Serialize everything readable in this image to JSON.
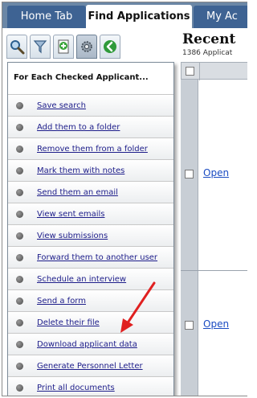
{
  "tabs": {
    "home": "Home Tab",
    "find": "Find Applications",
    "my": "My Ac"
  },
  "toolbar": {
    "icons": [
      "search-icon",
      "filter-icon",
      "add-document-icon",
      "settings-icon",
      "back-arrow-icon"
    ]
  },
  "menu": {
    "header": "For Each Checked Applicant...",
    "items": [
      "Save search",
      "Add them to a folder",
      "Remove them from a folder",
      "Mark them with notes",
      "Send them an email",
      "View sent emails",
      "View submissions",
      "Forward them to another user",
      "Schedule an interview",
      "Send a form",
      "Delete their file",
      "Download applicant data",
      "Generate Personnel Letter",
      "Print all documents"
    ]
  },
  "results": {
    "title": "Recent",
    "subtitle": "1386 Applicat",
    "open_label": "Open"
  },
  "colors": {
    "tabbar": "#6b87a6",
    "tab_inactive": "#3e6393",
    "link": "#1d1d8a",
    "arrow": "#e02020"
  }
}
